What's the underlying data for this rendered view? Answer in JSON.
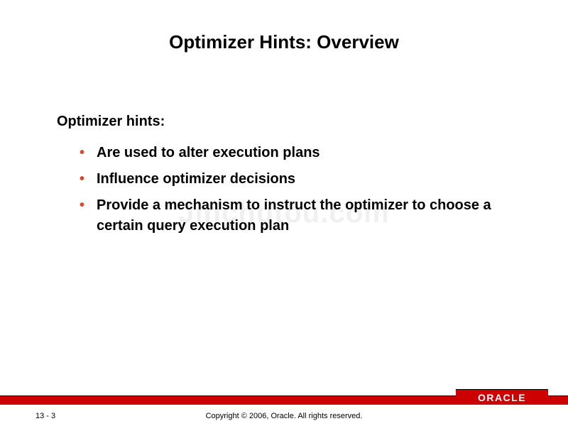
{
  "title": "Optimizer Hints: Overview",
  "lead": "Optimizer hints:",
  "bullets": [
    "Are used to alter execution plans",
    "Influence optimizer decisions",
    "Provide a mechanism to instruct the optimizer to choose a certain query execution plan"
  ],
  "watermark": "Jinchutou.com",
  "footer": {
    "page": "13 - 3",
    "copyright": "Copyright © 2006, Oracle. All rights reserved.",
    "logo": "ORACLE"
  }
}
